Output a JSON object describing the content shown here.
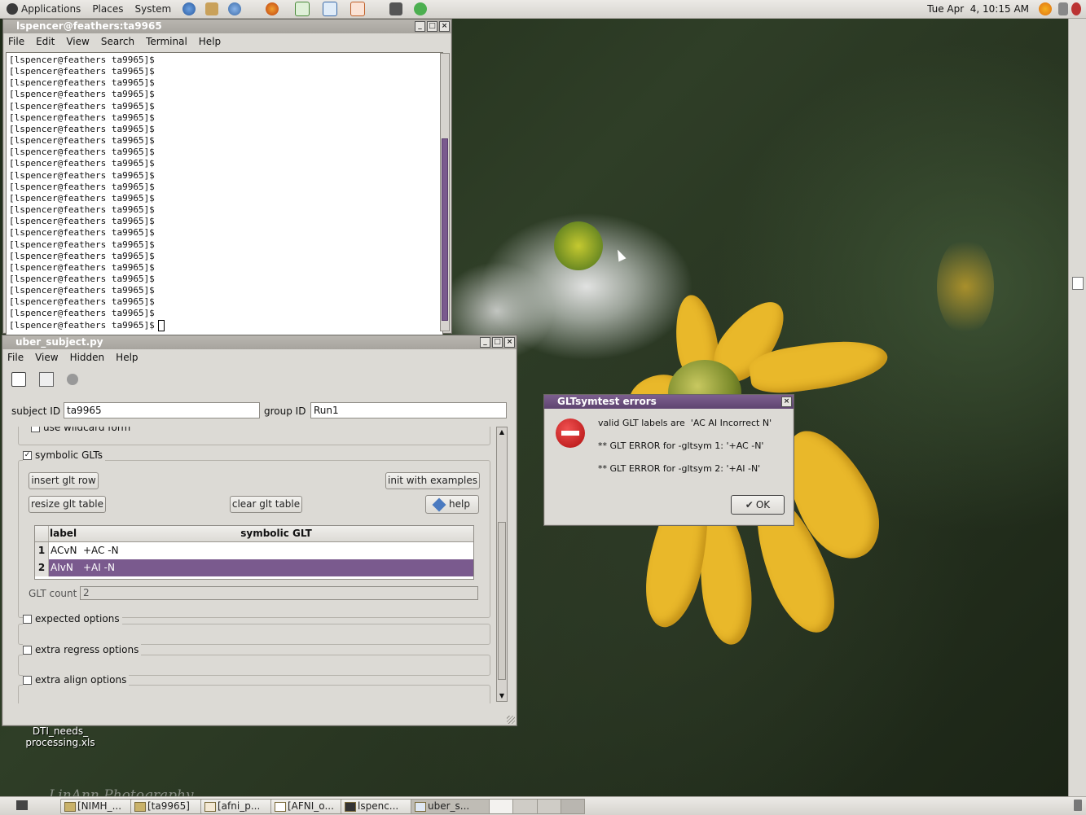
{
  "top_panel": {
    "menus": [
      "Applications",
      "Places",
      "System"
    ],
    "clock": "Tue Apr  4, 10:15 AM"
  },
  "terminal": {
    "title": "lspencer@feathers:ta9965",
    "menu": [
      "File",
      "Edit",
      "View",
      "Search",
      "Terminal",
      "Help"
    ],
    "prompt_line": "[lspencer@feathers ta9965]$",
    "line_count": 24
  },
  "uber": {
    "title": "uber_subject.py",
    "menu": [
      "File",
      "View",
      "Hidden",
      "Help"
    ],
    "subject_id_label": "subject ID",
    "subject_id_value": "ta9965",
    "group_id_label": "group ID",
    "group_id_value": "Run1",
    "wildcard_label": "use wildcard form",
    "symbolic_glts_label": "symbolic GLTs",
    "symbolic_glts_checked": true,
    "buttons": {
      "insert": "insert glt row",
      "init": "init with examples",
      "resize": "resize glt table",
      "clear": "clear glt table",
      "help": "help"
    },
    "table": {
      "headers": [
        "label",
        "symbolic GLT"
      ],
      "rows": [
        {
          "num": "1",
          "label": "ACvN",
          "glt": "+AC -N"
        },
        {
          "num": "2",
          "label": "AIvN",
          "glt": "+AI -N"
        }
      ]
    },
    "glt_count_label": "GLT count",
    "glt_count_value": "2",
    "sections": {
      "expected": "expected options",
      "regress": "extra regress options",
      "align": "extra align options"
    }
  },
  "dialog": {
    "title": "GLTsymtest errors",
    "lines": [
      "valid GLT labels are  'AC AI Incorrect N'",
      "** GLT ERROR for -gltsym 1: '+AC -N'",
      "** GLT ERROR for -gltsym 2: '+AI -N'"
    ],
    "ok_label": "OK"
  },
  "desktop": {
    "file_icon_label": "DTI_needs_\nprocessing.xls",
    "watermark": "LinAnn Photography"
  },
  "taskbar": {
    "items": [
      "[NIMH_...",
      "[ta9965]",
      "[afni_p...",
      "[AFNI_o...",
      "lspenc...",
      "uber_s..."
    ]
  },
  "colors": {
    "active_title": "#5e4470",
    "selection": "#7a5a8e",
    "flower": "#e9b82a"
  }
}
